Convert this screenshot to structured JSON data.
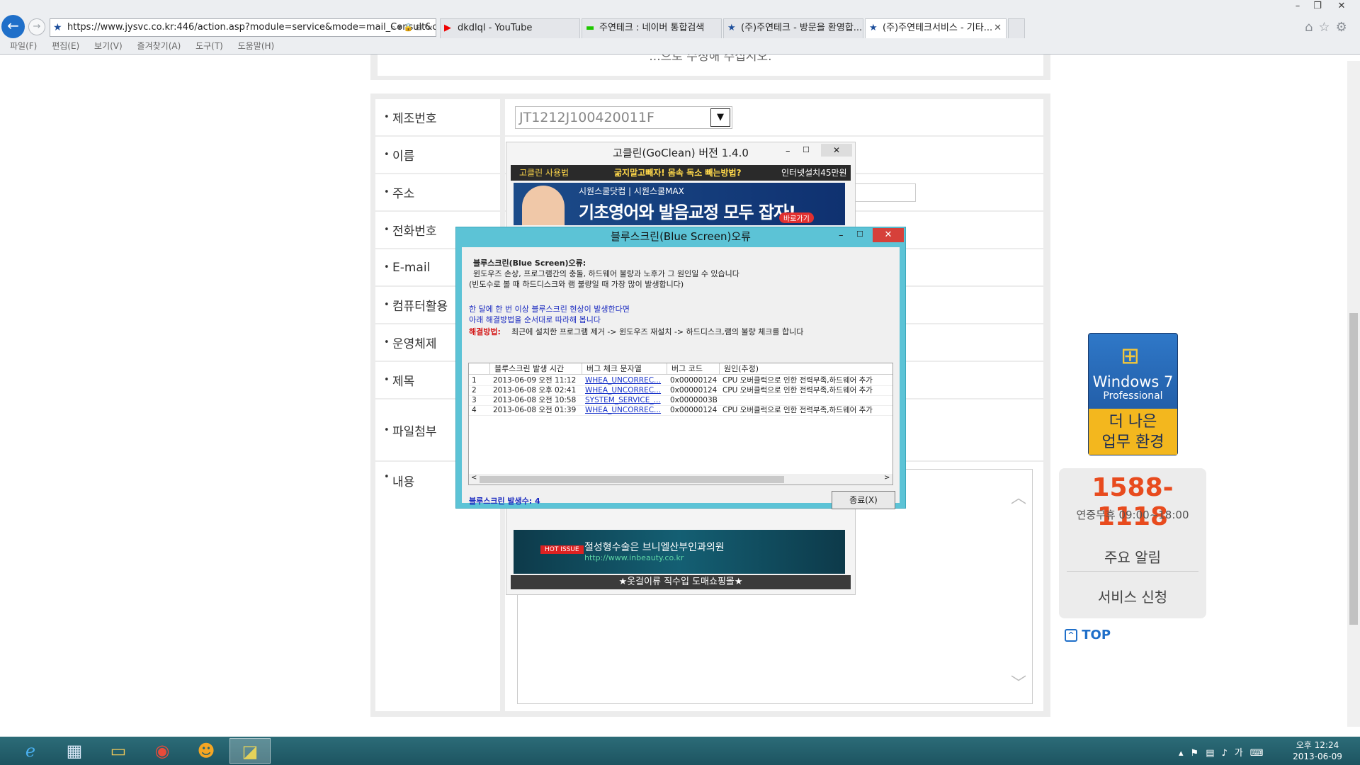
{
  "browser": {
    "url": "https://www.jysvc.co.kr:446/action.asp?module=service&mode=mail_Consult&c",
    "tabs": [
      {
        "label": "dkdlql - YouTube",
        "icon": "youtube-icon"
      },
      {
        "label": "주연테크 : 네이버 통합검색",
        "icon": "naver-icon"
      },
      {
        "label": "(주)주연테크 - 방문을 환영합...",
        "icon": "star-icon"
      },
      {
        "label": "(주)주연테크서비스 - 기타...",
        "icon": "star-icon",
        "active": true
      }
    ],
    "menu": [
      "파일(F)",
      "편집(E)",
      "보기(V)",
      "즐겨찾기(A)",
      "도구(T)",
      "도움말(H)"
    ]
  },
  "form": {
    "labels": [
      "제조번호",
      "이름",
      "주소",
      "전화번호",
      "E-mail",
      "컴퓨터활용",
      "운영체제",
      "제목",
      "파일첨부",
      "내용"
    ],
    "serial_value": "JT1212J100420011F",
    "top_text": "...으로 수정해 주십시오."
  },
  "sidebar": {
    "win7_name": "Windows 7",
    "win7_edition": "Professional",
    "win7_slogan_1": "더 나은",
    "win7_slogan_2": "업무 환경",
    "phone": "1588-1118",
    "hours": "연중무휴 09:00~18:00",
    "notice": "주요 알림",
    "service": "서비스 신청",
    "top": "TOP"
  },
  "goclean": {
    "title": "고클린(GoClean) 버전 1.4.0",
    "bar_usage": "고클린 사용법",
    "bar_promo": "굶지말고빼자! 몸속 독소 빼는방법?",
    "bar_right": "인터넷설치45만원",
    "banner_brand": "시원스쿨닷컴 | 시원스쿨MAX",
    "banner_main": "기초영어와 발음교정 모두 잡자!",
    "banner_btn": "바로가기",
    "ad2_tag": "HOT ISSUE",
    "ad2_text": "절성형수술은 브니엘산부인과의원",
    "ad2_url": "http://www.inbeauty.co.kr",
    "footer": "★옷걸이류 직수입 도매쇼핑몰★"
  },
  "dialog": {
    "title": "블루스크린(Blue Screen)오류",
    "heading": "블루스크린(Blue Screen)오류:",
    "line1": "윈도우즈 손상, 프로그램간의 충돌, 하드웨어 불량과 노후가 그 원인일 수 있습니다",
    "line2": "(빈도수로 볼 때 하드디스크와 램 불량일 때 가장 많이 발생합니다)",
    "blue1": "한 달에 한 번 이상 블루스크린 현상이 발생한다면",
    "blue2": "아래 해결방법을 순서대로 따라해 봅니다",
    "solution_label": "해결방법:",
    "solution_text": "최근에 설치한 프로그램 제거 -> 윈도우즈 재설치 -> 하드디스크,램의 불량 체크를 합니다",
    "columns": [
      "블루스크린 발생 시간",
      "버그 체크 문자열",
      "버그 코드",
      "원인(추정)"
    ],
    "rows": [
      {
        "n": "1",
        "time": "2013-06-09 오전 11:12",
        "check": "WHEA_UNCORREC...",
        "code": "0x00000124",
        "cause": "CPU 오버클럭으로 인한 전력부족,하드웨어 추가"
      },
      {
        "n": "2",
        "time": "2013-06-08 오후 02:41",
        "check": "WHEA_UNCORREC...",
        "code": "0x00000124",
        "cause": "CPU 오버클럭으로 인한 전력부족,하드웨어 추가"
      },
      {
        "n": "3",
        "time": "2013-06-08 오전 10:58",
        "check": "SYSTEM_SERVICE_...",
        "code": "0x0000003B",
        "cause": ""
      },
      {
        "n": "4",
        "time": "2013-06-08 오전 01:39",
        "check": "WHEA_UNCORREC...",
        "code": "0x00000124",
        "cause": "CPU 오버클럭으로 인한 전력부족,하드웨어 추가"
      }
    ],
    "count_label": "블루스크린 발생수: 4",
    "close_label": "종료(X)"
  },
  "taskbar": {
    "time": "오후 12:24",
    "date": "2013-06-09",
    "ime": "가"
  }
}
